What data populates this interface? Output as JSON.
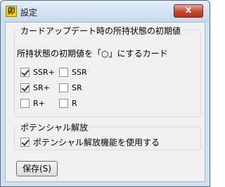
{
  "window": {
    "title": "設定",
    "app_icon_glyph": "卯",
    "close_glyph": "x"
  },
  "card_group": {
    "legend": "カードアップデート時の所持状態の初期値",
    "description": "所持状態の初期値を「○」にするカード",
    "options": [
      {
        "label": "SSR+",
        "checked": true
      },
      {
        "label": "SSR",
        "checked": false
      },
      {
        "label": "SR+",
        "checked": true
      },
      {
        "label": "SR",
        "checked": false
      },
      {
        "label": "R+",
        "checked": false
      },
      {
        "label": "R",
        "checked": false
      }
    ]
  },
  "potential_group": {
    "legend": "ポテンシャル解放",
    "option": {
      "label": "ポテンシャル解放機能を使用する",
      "checked": true
    }
  },
  "save_button": {
    "label": "保存(S)"
  }
}
